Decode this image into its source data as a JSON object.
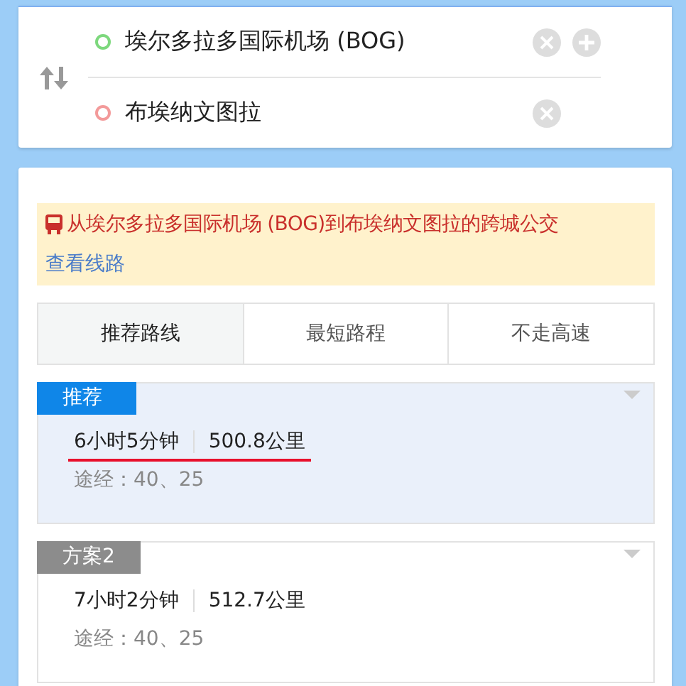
{
  "stops": [
    {
      "name": "埃尔多拉多国际机场 (BOG)",
      "color": "#7dd87d",
      "addable": true
    },
    {
      "name": "布埃纳文图拉",
      "color": "#f39a9a",
      "addable": false
    }
  ],
  "notice": {
    "text": "从埃尔多拉多国际机场 (BOG)到布埃纳文图拉的跨城公交",
    "link": "查看线路"
  },
  "tabs": [
    {
      "label": "推荐路线",
      "selected": true
    },
    {
      "label": "最短路程",
      "selected": false
    },
    {
      "label": "不走高速",
      "selected": false
    }
  ],
  "routes": [
    {
      "tag": "推荐",
      "selected": true,
      "time": "6小时5分钟",
      "distance": "500.8公里",
      "via": "途经：40、25"
    },
    {
      "tag": "方案2",
      "selected": false,
      "time": "7小时2分钟",
      "distance": "512.7公里",
      "via": "途经：40、25"
    }
  ]
}
